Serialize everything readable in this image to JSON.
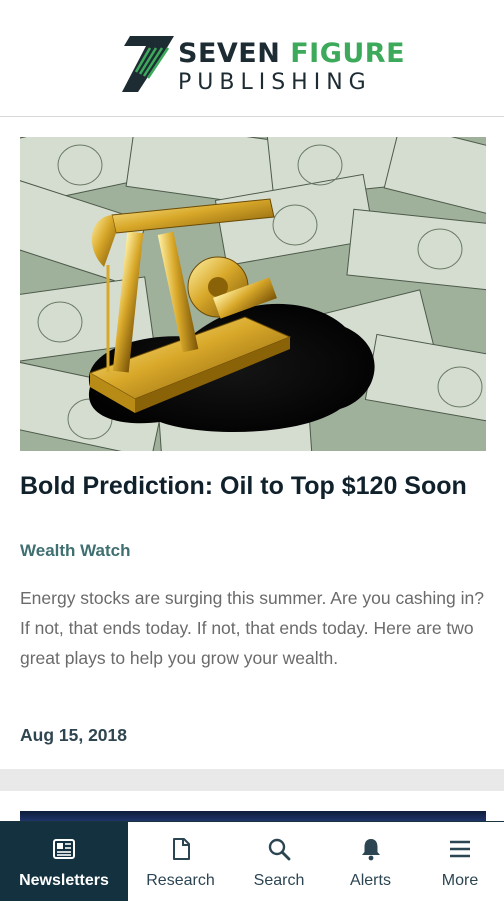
{
  "header": {
    "brand_line1_a": "SEVEN",
    "brand_line1_b": "FIGURE",
    "brand_line2": "PUBLISHING",
    "brand_mark_digit": "7",
    "colors": {
      "dark": "#1d2b33",
      "green": "#3daa5b"
    }
  },
  "article": {
    "image": "gold-oil-pump-on-dollar-bills",
    "title": "Bold Prediction: Oil to Top $120 Soon",
    "source": "Wealth Watch",
    "summary": "Energy stocks are surging this summer. Are you cashing in? If not, that ends today. If not, that ends today. Here are two great plays to help you grow your wealth.",
    "date": "Aug 15, 2018"
  },
  "nav": {
    "active": "newsletters",
    "items": [
      {
        "id": "newsletters",
        "label": "Newsletters",
        "icon": "newspaper-icon"
      },
      {
        "id": "research",
        "label": "Research",
        "icon": "document-icon"
      },
      {
        "id": "search",
        "label": "Search",
        "icon": "search-icon"
      },
      {
        "id": "alerts",
        "label": "Alerts",
        "icon": "bell-icon"
      },
      {
        "id": "more",
        "label": "More",
        "icon": "menu-icon"
      }
    ],
    "colors": {
      "active_bg": "#13313f",
      "text": "#2c4552"
    }
  }
}
